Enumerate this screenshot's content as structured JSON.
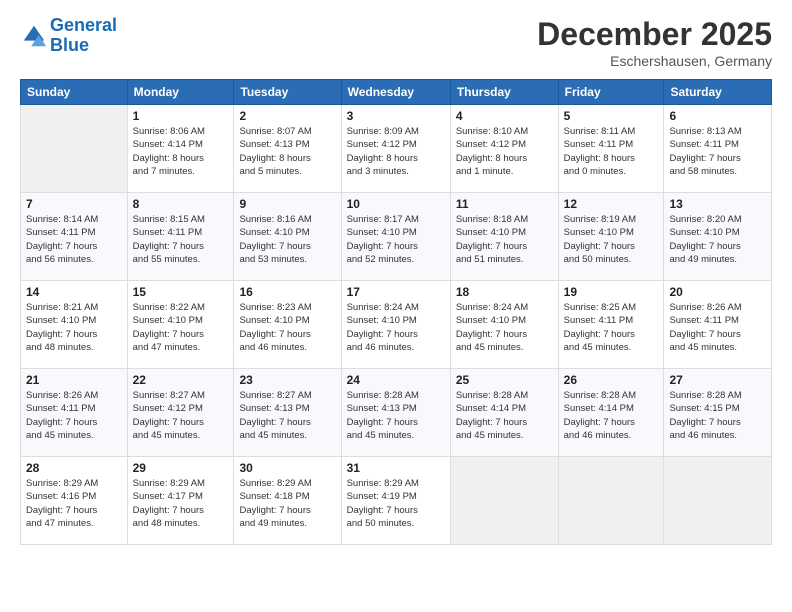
{
  "logo": {
    "line1": "General",
    "line2": "Blue"
  },
  "header": {
    "month": "December 2025",
    "location": "Eschershausen, Germany"
  },
  "weekdays": [
    "Sunday",
    "Monday",
    "Tuesday",
    "Wednesday",
    "Thursday",
    "Friday",
    "Saturday"
  ],
  "weeks": [
    [
      {
        "day": "",
        "info": ""
      },
      {
        "day": "1",
        "info": "Sunrise: 8:06 AM\nSunset: 4:14 PM\nDaylight: 8 hours\nand 7 minutes."
      },
      {
        "day": "2",
        "info": "Sunrise: 8:07 AM\nSunset: 4:13 PM\nDaylight: 8 hours\nand 5 minutes."
      },
      {
        "day": "3",
        "info": "Sunrise: 8:09 AM\nSunset: 4:12 PM\nDaylight: 8 hours\nand 3 minutes."
      },
      {
        "day": "4",
        "info": "Sunrise: 8:10 AM\nSunset: 4:12 PM\nDaylight: 8 hours\nand 1 minute."
      },
      {
        "day": "5",
        "info": "Sunrise: 8:11 AM\nSunset: 4:11 PM\nDaylight: 8 hours\nand 0 minutes."
      },
      {
        "day": "6",
        "info": "Sunrise: 8:13 AM\nSunset: 4:11 PM\nDaylight: 7 hours\nand 58 minutes."
      }
    ],
    [
      {
        "day": "7",
        "info": "Sunrise: 8:14 AM\nSunset: 4:11 PM\nDaylight: 7 hours\nand 56 minutes."
      },
      {
        "day": "8",
        "info": "Sunrise: 8:15 AM\nSunset: 4:11 PM\nDaylight: 7 hours\nand 55 minutes."
      },
      {
        "day": "9",
        "info": "Sunrise: 8:16 AM\nSunset: 4:10 PM\nDaylight: 7 hours\nand 53 minutes."
      },
      {
        "day": "10",
        "info": "Sunrise: 8:17 AM\nSunset: 4:10 PM\nDaylight: 7 hours\nand 52 minutes."
      },
      {
        "day": "11",
        "info": "Sunrise: 8:18 AM\nSunset: 4:10 PM\nDaylight: 7 hours\nand 51 minutes."
      },
      {
        "day": "12",
        "info": "Sunrise: 8:19 AM\nSunset: 4:10 PM\nDaylight: 7 hours\nand 50 minutes."
      },
      {
        "day": "13",
        "info": "Sunrise: 8:20 AM\nSunset: 4:10 PM\nDaylight: 7 hours\nand 49 minutes."
      }
    ],
    [
      {
        "day": "14",
        "info": "Sunrise: 8:21 AM\nSunset: 4:10 PM\nDaylight: 7 hours\nand 48 minutes."
      },
      {
        "day": "15",
        "info": "Sunrise: 8:22 AM\nSunset: 4:10 PM\nDaylight: 7 hours\nand 47 minutes."
      },
      {
        "day": "16",
        "info": "Sunrise: 8:23 AM\nSunset: 4:10 PM\nDaylight: 7 hours\nand 46 minutes."
      },
      {
        "day": "17",
        "info": "Sunrise: 8:24 AM\nSunset: 4:10 PM\nDaylight: 7 hours\nand 46 minutes."
      },
      {
        "day": "18",
        "info": "Sunrise: 8:24 AM\nSunset: 4:10 PM\nDaylight: 7 hours\nand 45 minutes."
      },
      {
        "day": "19",
        "info": "Sunrise: 8:25 AM\nSunset: 4:11 PM\nDaylight: 7 hours\nand 45 minutes."
      },
      {
        "day": "20",
        "info": "Sunrise: 8:26 AM\nSunset: 4:11 PM\nDaylight: 7 hours\nand 45 minutes."
      }
    ],
    [
      {
        "day": "21",
        "info": "Sunrise: 8:26 AM\nSunset: 4:11 PM\nDaylight: 7 hours\nand 45 minutes."
      },
      {
        "day": "22",
        "info": "Sunrise: 8:27 AM\nSunset: 4:12 PM\nDaylight: 7 hours\nand 45 minutes."
      },
      {
        "day": "23",
        "info": "Sunrise: 8:27 AM\nSunset: 4:13 PM\nDaylight: 7 hours\nand 45 minutes."
      },
      {
        "day": "24",
        "info": "Sunrise: 8:28 AM\nSunset: 4:13 PM\nDaylight: 7 hours\nand 45 minutes."
      },
      {
        "day": "25",
        "info": "Sunrise: 8:28 AM\nSunset: 4:14 PM\nDaylight: 7 hours\nand 45 minutes."
      },
      {
        "day": "26",
        "info": "Sunrise: 8:28 AM\nSunset: 4:14 PM\nDaylight: 7 hours\nand 46 minutes."
      },
      {
        "day": "27",
        "info": "Sunrise: 8:28 AM\nSunset: 4:15 PM\nDaylight: 7 hours\nand 46 minutes."
      }
    ],
    [
      {
        "day": "28",
        "info": "Sunrise: 8:29 AM\nSunset: 4:16 PM\nDaylight: 7 hours\nand 47 minutes."
      },
      {
        "day": "29",
        "info": "Sunrise: 8:29 AM\nSunset: 4:17 PM\nDaylight: 7 hours\nand 48 minutes."
      },
      {
        "day": "30",
        "info": "Sunrise: 8:29 AM\nSunset: 4:18 PM\nDaylight: 7 hours\nand 49 minutes."
      },
      {
        "day": "31",
        "info": "Sunrise: 8:29 AM\nSunset: 4:19 PM\nDaylight: 7 hours\nand 50 minutes."
      },
      {
        "day": "",
        "info": ""
      },
      {
        "day": "",
        "info": ""
      },
      {
        "day": "",
        "info": ""
      }
    ]
  ]
}
